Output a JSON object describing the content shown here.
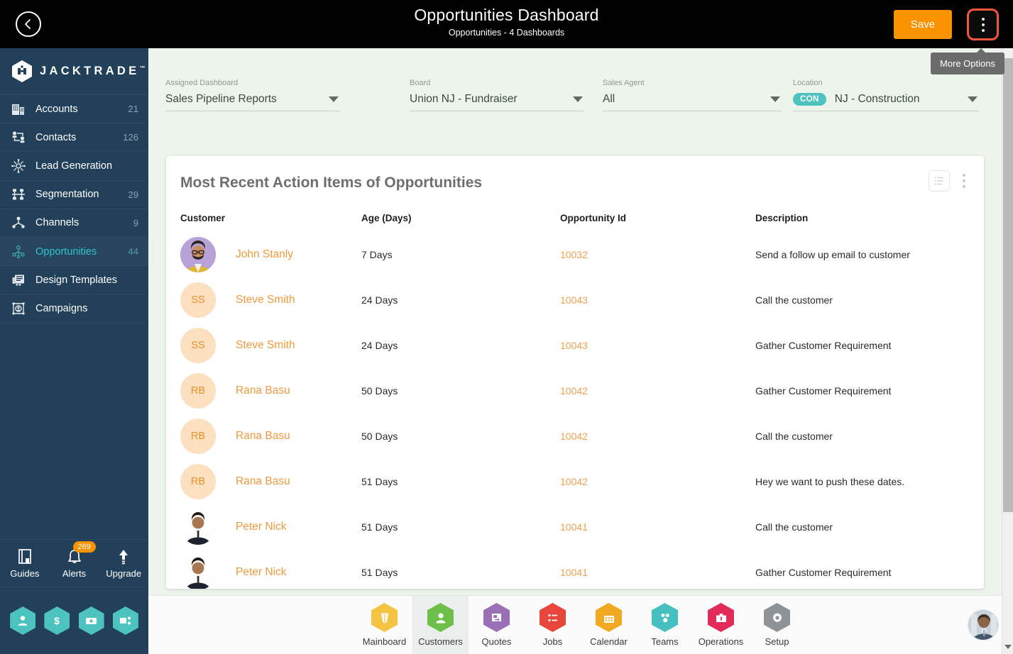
{
  "topbar": {
    "back_icon": "chevron-left-icon",
    "title": "Opportunities Dashboard",
    "subtitle": "Opportunities - 4 Dashboards",
    "save_label": "Save",
    "more_icon": "vertical-dots-icon",
    "tooltip": "More Options",
    "accent_orange": "#fb9300",
    "highlight_border": "#f4553d",
    "background": "#000000"
  },
  "sidebar": {
    "brand": "JACKTRADE",
    "brand_tm": "™",
    "background": "#23405a",
    "active_color": "#31c5c8",
    "items": [
      {
        "label": "Accounts",
        "count": "21",
        "icon": "building-icon",
        "active": false
      },
      {
        "label": "Contacts",
        "count": "126",
        "icon": "contacts-network-icon",
        "active": false
      },
      {
        "label": "Lead Generation",
        "count": "",
        "icon": "lead-burst-icon",
        "active": false
      },
      {
        "label": "Segmentation",
        "count": "29",
        "icon": "segmentation-icon",
        "active": false
      },
      {
        "label": "Channels",
        "count": "9",
        "icon": "channels-tree-icon",
        "active": false
      },
      {
        "label": "Opportunities",
        "count": "44",
        "icon": "opportunities-icon",
        "active": true
      },
      {
        "label": "Design Templates",
        "count": "",
        "icon": "design-templates-icon",
        "active": false
      },
      {
        "label": "Campaigns",
        "count": "",
        "icon": "campaigns-icon",
        "active": false
      }
    ],
    "tools": [
      {
        "label": "Guides",
        "icon": "book-icon",
        "badge": ""
      },
      {
        "label": "Alerts",
        "icon": "bell-icon",
        "badge": "269"
      },
      {
        "label": "Upgrade",
        "icon": "up-arrow-icon",
        "badge": ""
      }
    ],
    "quick_hexes": [
      {
        "icon": "person-icon"
      },
      {
        "icon": "dollar-icon"
      },
      {
        "icon": "payment-icon"
      },
      {
        "icon": "workflow-icon"
      }
    ],
    "badge_color": "#f59300",
    "hex_color": "#4cc3bf"
  },
  "filters": [
    {
      "label": "Assigned Dashboard",
      "value": "Sales Pipeline Reports",
      "chip": ""
    },
    {
      "label": "Board",
      "value": "Union NJ - Fundraiser",
      "chip": ""
    },
    {
      "label": "Sales Agent",
      "value": "All",
      "chip": ""
    },
    {
      "label": "Location",
      "value": "NJ - Construction",
      "chip": "CON"
    }
  ],
  "card": {
    "title": "Most Recent Action Items of Opportunities",
    "list_view_icon": "list-view-icon",
    "kebab_icon": "vertical-dots-icon",
    "columns": [
      "Customer",
      "Age (Days)",
      "Opportunity Id",
      "Description"
    ],
    "rows": [
      {
        "customer": "John Stanly",
        "avatar_type": "photo",
        "initials": "",
        "avatar_bg": "#b6a2d6",
        "age": "7 Days",
        "opportunity_id": "10032",
        "description": "Send a follow up email to customer"
      },
      {
        "customer": "Steve Smith",
        "avatar_type": "initials",
        "initials": "SS",
        "avatar_bg": "#fce0c0",
        "age": "24 Days",
        "opportunity_id": "10043",
        "description": "Call the customer"
      },
      {
        "customer": "Steve Smith",
        "avatar_type": "initials",
        "initials": "SS",
        "avatar_bg": "#fce0c0",
        "age": "24 Days",
        "opportunity_id": "10043",
        "description": "Gather Customer Requirement"
      },
      {
        "customer": "Rana Basu",
        "avatar_type": "initials",
        "initials": "RB",
        "avatar_bg": "#fce0c0",
        "age": "50 Days",
        "opportunity_id": "10042",
        "description": "Gather Customer Requirement"
      },
      {
        "customer": "Rana Basu",
        "avatar_type": "initials",
        "initials": "RB",
        "avatar_bg": "#fce0c0",
        "age": "50 Days",
        "opportunity_id": "10042",
        "description": "Call the customer"
      },
      {
        "customer": "Rana Basu",
        "avatar_type": "initials",
        "initials": "RB",
        "avatar_bg": "#fce0c0",
        "age": "51 Days",
        "opportunity_id": "10042",
        "description": "Hey we want to push these dates."
      },
      {
        "customer": "Peter Nick",
        "avatar_type": "photo2",
        "initials": "",
        "avatar_bg": "#e9eef2",
        "age": "51 Days",
        "opportunity_id": "10041",
        "description": "Call the customer"
      },
      {
        "customer": "Peter Nick",
        "avatar_type": "photo2",
        "initials": "",
        "avatar_bg": "#e9eef2",
        "age": "51 Days",
        "opportunity_id": "10041",
        "description": "Gather Customer Requirement"
      }
    ],
    "name_color": "#f09a3e"
  },
  "bottom_nav": {
    "items": [
      {
        "label": "Mainboard",
        "icon": "mainboard-icon",
        "color": "#f5c342",
        "active": false
      },
      {
        "label": "Customers",
        "icon": "customers-icon",
        "color": "#6cc04a",
        "active": true
      },
      {
        "label": "Quotes",
        "icon": "quotes-icon",
        "color": "#9b6fb5",
        "active": false
      },
      {
        "label": "Jobs",
        "icon": "jobs-icon",
        "color": "#e8453c",
        "active": false
      },
      {
        "label": "Calendar",
        "icon": "calendar-icon",
        "color": "#f2a922",
        "active": false
      },
      {
        "label": "Teams",
        "icon": "teams-icon",
        "color": "#46bfc0",
        "active": false
      },
      {
        "label": "Operations",
        "icon": "operations-icon",
        "color": "#e32b59",
        "active": false
      },
      {
        "label": "Setup",
        "icon": "setup-icon",
        "color": "#8d9396",
        "active": false
      }
    ],
    "user_avatar_icon": "user-avatar"
  }
}
